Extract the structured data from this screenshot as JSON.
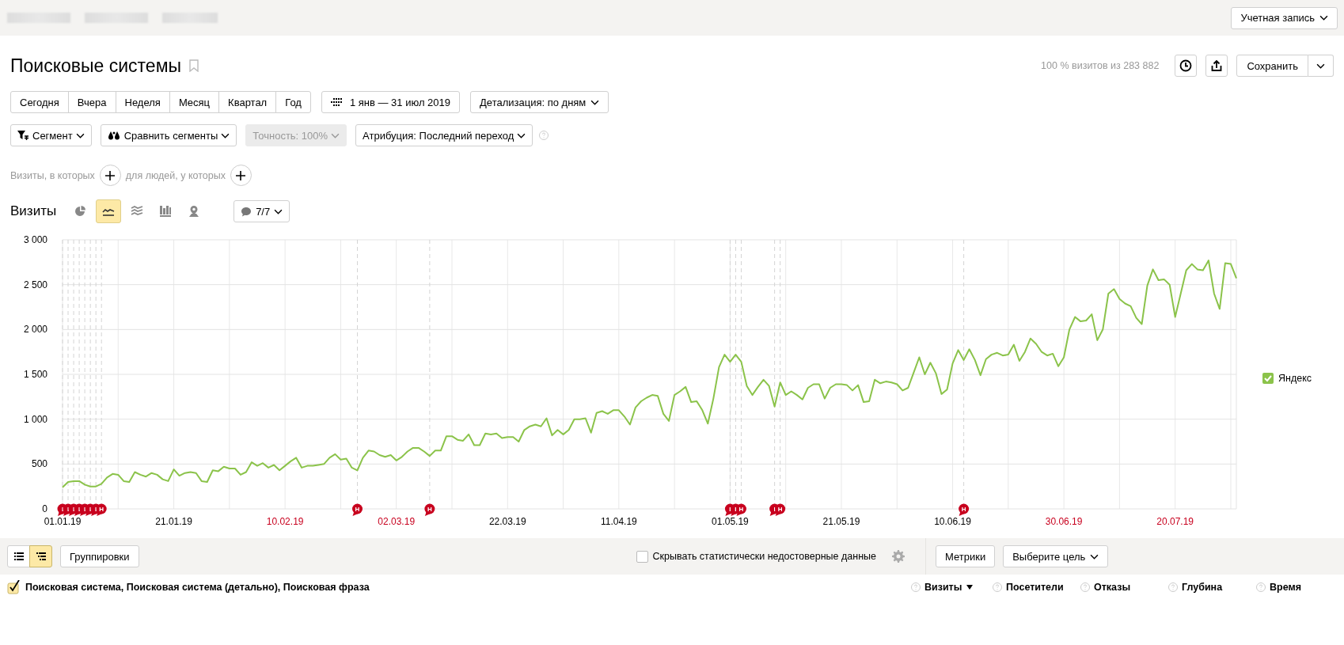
{
  "top_bar": {
    "account_button": "Учетная запись"
  },
  "header": {
    "title": "Поисковые системы",
    "bookmarked": false,
    "visits_share": "100 % визитов из 283 882",
    "save_button": "Сохранить"
  },
  "period_buttons": [
    {
      "label": "Сегодня",
      "selected": false
    },
    {
      "label": "Вчера",
      "selected": false
    },
    {
      "label": "Неделя",
      "selected": false
    },
    {
      "label": "Месяц",
      "selected": false
    },
    {
      "label": "Квартал",
      "selected": false
    },
    {
      "label": "Год",
      "selected": false
    }
  ],
  "date_range": "1 янв — 31 июл 2019",
  "detail_dropdown": "Детализация: по дням",
  "filters": [
    {
      "kind": "segment",
      "label": "Сегмент",
      "disabled": false
    },
    {
      "kind": "compare",
      "label": "Сравнить сегменты",
      "disabled": false
    },
    {
      "kind": "accuracy",
      "label": "Точность: 100%",
      "disabled": true
    },
    {
      "kind": "attribution",
      "label": "Атрибуция: Последний переход",
      "disabled": false
    }
  ],
  "conditions": {
    "visits_label": "Визиты, в которых",
    "people_label": "для людей, у которых"
  },
  "chart_header": {
    "title": "Визиты",
    "view_buttons": [
      {
        "kind": "pie",
        "selected": false
      },
      {
        "kind": "line",
        "selected": true
      },
      {
        "kind": "area",
        "selected": false
      },
      {
        "kind": "bar",
        "selected": false
      },
      {
        "kind": "map",
        "selected": false
      }
    ],
    "annotations_button": "7/7"
  },
  "chart_data": {
    "type": "line",
    "grid": true,
    "ylim": [
      0,
      3000
    ],
    "categories": [
      "01.01.19",
      null,
      null,
      null,
      null,
      null,
      null,
      null,
      null,
      null,
      null,
      null,
      null,
      null,
      null,
      null,
      null,
      null,
      null,
      null,
      "21.01.19",
      null,
      null,
      null,
      null,
      null,
      null,
      null,
      null,
      null,
      null,
      null,
      null,
      null,
      null,
      null,
      null,
      null,
      null,
      null,
      "10.02.19",
      null,
      null,
      null,
      null,
      null,
      null,
      null,
      null,
      null,
      null,
      null,
      null,
      null,
      null,
      null,
      null,
      null,
      null,
      null,
      "02.03.19",
      null,
      null,
      null,
      null,
      null,
      null,
      null,
      null,
      null,
      null,
      null,
      null,
      null,
      null,
      null,
      null,
      null,
      null,
      null,
      "22.03.19",
      null,
      null,
      null,
      null,
      null,
      null,
      null,
      null,
      null,
      null,
      null,
      null,
      null,
      null,
      null,
      null,
      null,
      null,
      null,
      "11.04.19",
      null,
      null,
      null,
      null,
      null,
      null,
      null,
      null,
      null,
      null,
      null,
      null,
      null,
      null,
      null,
      null,
      null,
      null,
      null,
      "01.05.19",
      null,
      null,
      null,
      null,
      null,
      null,
      null,
      null,
      null,
      null,
      null,
      null,
      null,
      null,
      null,
      null,
      null,
      null,
      null,
      "21.05.19",
      null,
      null,
      null,
      null,
      null,
      null,
      null,
      null,
      null,
      null,
      null,
      null,
      null,
      null,
      null,
      null,
      null,
      null,
      null,
      "10.06.19",
      null,
      null,
      null,
      null,
      null,
      null,
      null,
      null,
      null,
      null,
      null,
      null,
      null,
      null,
      null,
      null,
      null,
      null,
      null,
      "30.06.19",
      null,
      null,
      null,
      null,
      null,
      null,
      null,
      null,
      null,
      null,
      null,
      null,
      null,
      null,
      null,
      null,
      null,
      null,
      null,
      "20.07.19",
      null,
      null,
      null,
      null,
      null,
      null,
      null,
      null,
      null,
      null,
      null
    ],
    "yticks": [
      {
        "value": 0,
        "label": "0"
      },
      {
        "value": 500,
        "label": "500"
      },
      {
        "value": 1000,
        "label": "1 000"
      },
      {
        "value": 1500,
        "label": "1 500"
      },
      {
        "value": 2000,
        "label": "2 000"
      },
      {
        "value": 2500,
        "label": "2 500"
      },
      {
        "value": 3000,
        "label": "3 000"
      }
    ],
    "series": [
      {
        "name": "Яндекс",
        "color": "#8bc34a",
        "values": [
          240,
          300,
          310,
          310,
          270,
          250,
          250,
          280,
          350,
          390,
          380,
          310,
          300,
          410,
          380,
          360,
          400,
          380,
          330,
          310,
          440,
          370,
          400,
          410,
          400,
          310,
          300,
          430,
          420,
          470,
          450,
          450,
          380,
          410,
          520,
          480,
          510,
          460,
          490,
          430,
          480,
          530,
          570,
          460,
          480,
          480,
          490,
          500,
          570,
          610,
          550,
          560,
          460,
          430,
          570,
          650,
          640,
          600,
          580,
          600,
          540,
          580,
          640,
          680,
          680,
          640,
          590,
          650,
          650,
          810,
          810,
          770,
          760,
          830,
          710,
          710,
          840,
          830,
          840,
          790,
          800,
          800,
          750,
          880,
          920,
          940,
          920,
          1010,
          820,
          880,
          830,
          880,
          1000,
          1000,
          1010,
          850,
          1070,
          1090,
          1060,
          1100,
          1100,
          1030,
          940,
          1130,
          1200,
          1240,
          1270,
          1260,
          1060,
          980,
          1270,
          1310,
          1360,
          1190,
          1200,
          1100,
          950,
          1230,
          1580,
          1720,
          1640,
          1720,
          1640,
          1370,
          1270,
          1360,
          1440,
          1370,
          1140,
          1410,
          1270,
          1310,
          1270,
          1220,
          1350,
          1390,
          1390,
          1230,
          1350,
          1390,
          1390,
          1380,
          1320,
          1380,
          1190,
          1200,
          1440,
          1400,
          1420,
          1410,
          1390,
          1320,
          1350,
          1520,
          1690,
          1500,
          1630,
          1510,
          1280,
          1330,
          1620,
          1770,
          1660,
          1780,
          1660,
          1490,
          1670,
          1720,
          1740,
          1710,
          1720,
          1830,
          1650,
          1750,
          1900,
          1840,
          1750,
          1710,
          1730,
          1590,
          1690,
          2000,
          2140,
          2090,
          2100,
          2170,
          1880,
          2000,
          2400,
          2450,
          2340,
          2290,
          2260,
          2130,
          2060,
          2490,
          2670,
          2550,
          2560,
          2500,
          2140,
          2400,
          2660,
          2730,
          2670,
          2660,
          2770,
          2400,
          2230,
          2740,
          2730,
          2570
        ]
      }
    ],
    "annotations": [
      {
        "text": "I"
      },
      {
        "text": "I"
      },
      {
        "text": "I"
      },
      {
        "text": "I"
      },
      {
        "text": "I"
      },
      {
        "text": "I"
      },
      {
        "text": "I"
      },
      {
        "text": "H"
      },
      {
        "text": "H"
      },
      {
        "text": "H"
      },
      {
        "text": "I"
      },
      {
        "text": "I"
      },
      {
        "text": "H"
      },
      {
        "text": "I"
      },
      {
        "text": "H"
      },
      {
        "text": "H"
      }
    ]
  },
  "xtick_weekend": [
    false,
    false,
    true,
    true,
    false,
    false,
    false,
    false,
    false,
    true,
    true
  ],
  "legend": [
    {
      "checked": true
    }
  ],
  "table_toolbar": {
    "view_toggle": [
      {
        "kind": "list",
        "selected": false
      },
      {
        "kind": "tree",
        "selected": true
      }
    ],
    "groupings_button": "Группировки",
    "hide_unreliable": {
      "label": "Скрывать статистически недостоверные данные",
      "checked": false
    },
    "metrics_button": "Метрики",
    "goal_dropdown": "Выберите цель"
  },
  "table": {
    "grouping": {
      "label": "Поисковая система, Поисковая система (детально), Поисковая фраза",
      "checked": true
    },
    "columns": [
      {
        "label": "Визиты",
        "sorted": true
      },
      {
        "label": "Посетители",
        "sorted": false
      },
      {
        "label": "Отказы",
        "sorted": false
      },
      {
        "label": "Глубина",
        "sorted": false
      },
      {
        "label": "Время",
        "sorted": false
      }
    ]
  }
}
